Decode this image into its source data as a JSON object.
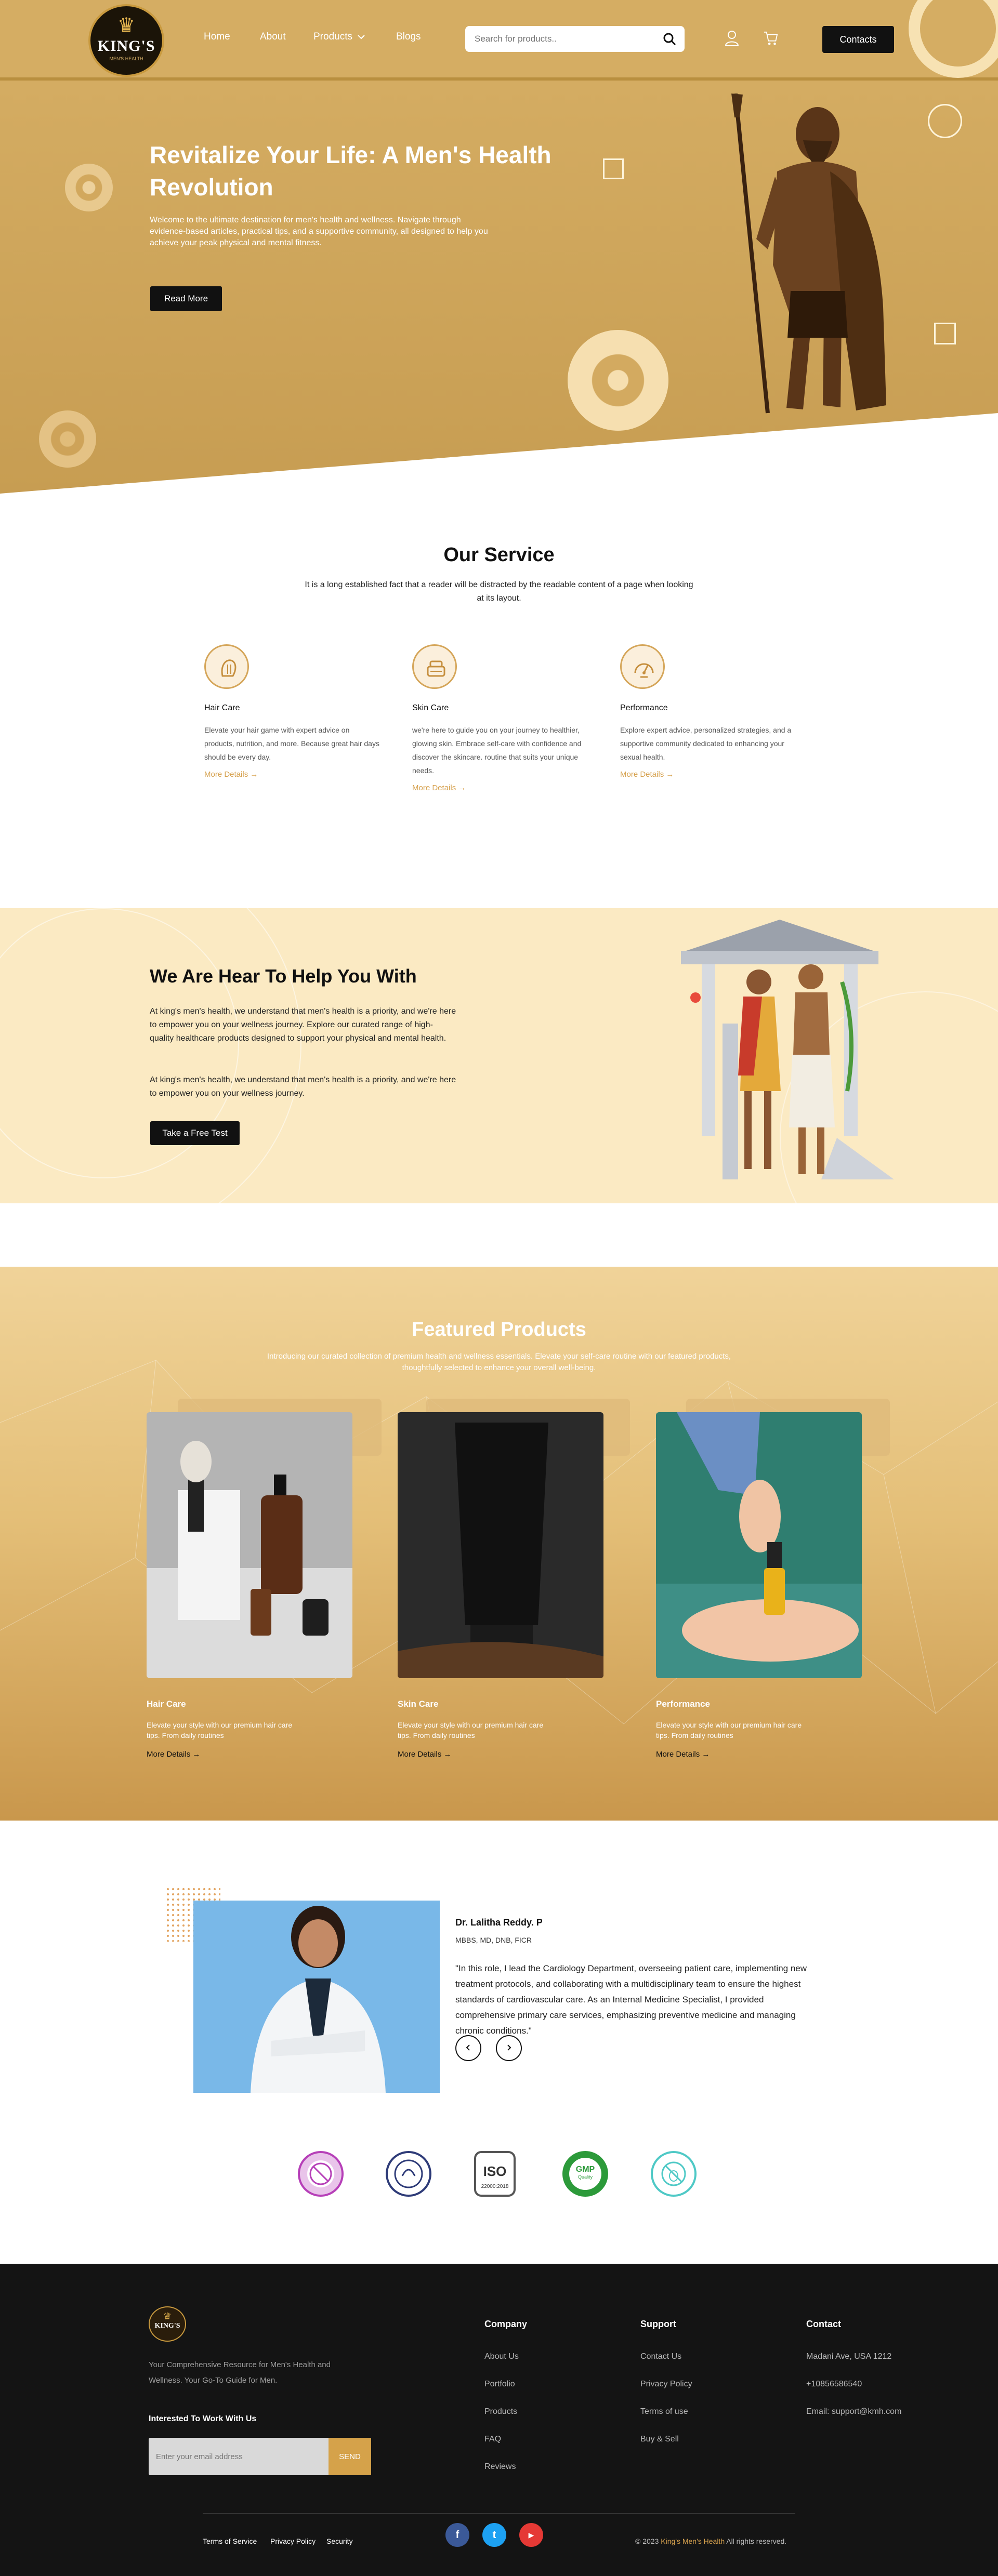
{
  "header": {
    "logo_word": "KING'S",
    "logo_tag": "MEN'S HEALTH",
    "nav": [
      "Home",
      "About",
      "Products",
      "Blogs"
    ],
    "search_placeholder": "Search for products..",
    "contacts_label": "Contacts"
  },
  "hero": {
    "title": "Revitalize Your Life: A Men's Health Revolution",
    "text": "Welcome to the ultimate destination for men's health and wellness. Navigate through evidence-based articles, practical tips, and a supportive community, all designed to help you achieve your peak physical and mental fitness.",
    "button": "Read More"
  },
  "services": {
    "title": "Our Service",
    "subtitle": "It is a long established fact that a reader will be distracted by the readable content of a page when looking at its layout.",
    "items": [
      {
        "icon": "hair-care-icon",
        "title": "Hair Care",
        "text": "Elevate your hair game with expert advice on products, nutrition, and more. Because great hair days should be every day.",
        "more": "More Details"
      },
      {
        "icon": "skin-care-icon",
        "title": "Skin Care",
        "text": "we're here to guide you on your journey to healthier, glowing skin. Embrace self-care with confidence and discover the skincare. routine that suits your unique needs.",
        "more": "More Details"
      },
      {
        "icon": "performance-icon",
        "title": "Performance",
        "text": "Explore expert advice, personalized strategies, and a supportive community dedicated to enhancing your sexual health.",
        "more": "More Details"
      }
    ]
  },
  "help": {
    "title": "We Are Hear To Help You With",
    "p1": "At king's men's health, we understand that men's health is a priority, and we're here to empower you on your wellness journey. Explore our curated range of high-quality healthcare products designed to support your physical and mental health.",
    "p2": "At king's men's health, we understand that men's health is a priority, and we're here to empower you on your wellness journey.",
    "button": "Take a Free Test"
  },
  "featured": {
    "title": "Featured Products",
    "subtitle": "Introducing our curated collection of premium health and wellness essentials. Elevate your self-care routine with our featured products, thoughtfully selected to enhance your overall well-being.",
    "products": [
      {
        "title": "Hair Care",
        "text": "Elevate your style with our premium hair care tips. From daily routines",
        "more": "More Details"
      },
      {
        "title": "Skin Care",
        "text": "Elevate your style with our premium hair care tips. From daily routines",
        "more": "More Details"
      },
      {
        "title": "Performance",
        "text": "Elevate your style with our premium hair care tips. From daily routines",
        "more": "More Details"
      }
    ]
  },
  "testimonial": {
    "name": "Dr. Lalitha Reddy. P",
    "credentials": "MBBS, MD, DNB, FICR",
    "quote": "\"In this role, I lead the Cardiology Department, overseeing patient care, implementing new treatment protocols, and collaborating with a multidisciplinary team to ensure the highest standards of cardiovascular care. As an Internal Medicine Specialist, I provided comprehensive primary care services, emphasizing preventive medicine and managing chronic conditions.\""
  },
  "badges": {
    "iso_top": "ISO",
    "iso_bottom": "22000:2018",
    "gmp_top": "GMP",
    "gmp_bottom": "Quality"
  },
  "footer": {
    "logo_word": "KING'S",
    "about": "Your Comprehensive Resource for Men's Health and Wellness. Your Go-To Guide for Men.",
    "work_title": "Interested To Work With Us",
    "email_placeholder": "Enter your email address",
    "send": "SEND",
    "company_title": "Company",
    "company_links": [
      "About Us",
      "Portfolio",
      "Products",
      "FAQ",
      "Reviews"
    ],
    "support_title": "Support",
    "support_links": [
      "Contact Us",
      "Privacy Policy",
      "Terms of use",
      "Buy & Sell"
    ],
    "contact_title": "Contact",
    "contact_lines": [
      "Madani Ave, USA 1212",
      "+10856586540",
      "Email: support@kmh.com"
    ],
    "bottom_links": [
      "Terms of Service",
      "Privacy Policy",
      "Security"
    ],
    "social": [
      "f",
      "t",
      "▶"
    ],
    "copyright_prefix": "© 2023",
    "copyright_brand": "King's Men's Health",
    "copyright_suffix": "All rights reserved."
  },
  "colors": {
    "gold": "#d5ad63",
    "dark": "#111111",
    "cream": "#fbeac3",
    "accent": "#d6a14e"
  }
}
